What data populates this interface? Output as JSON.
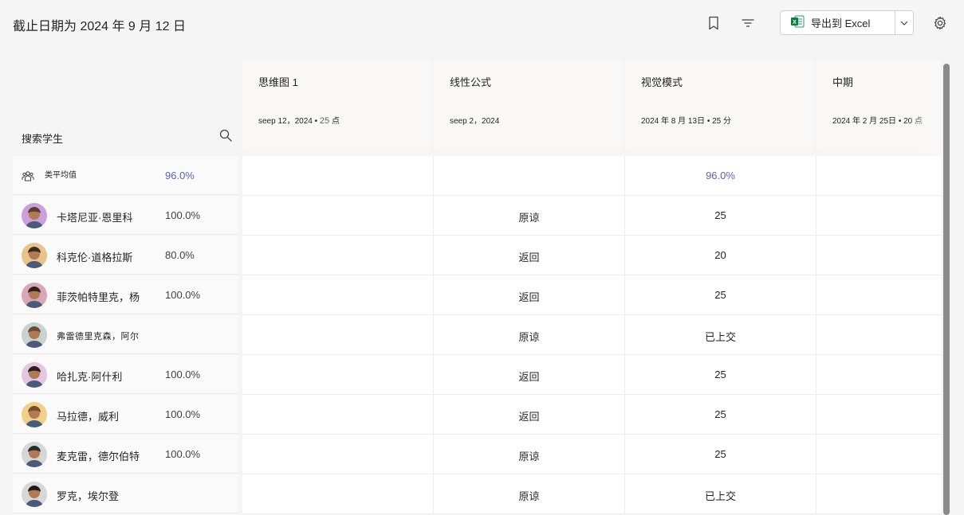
{
  "header": {
    "title": "截止日期为 2024 年 9 月 12 日",
    "export_label": "导出到 Excel"
  },
  "search": {
    "label": "搜索学生"
  },
  "average": {
    "label": "类平均值",
    "grade": "96.0%"
  },
  "columns": [
    {
      "title": "思维图 1",
      "sub": "seep 12，2024 •",
      "sub_points": "25",
      "sub_suffix": "点"
    },
    {
      "title": "线性公式",
      "sub": "seep 2，2024",
      "sub_points": "",
      "sub_suffix": ""
    },
    {
      "title": "视觉模式",
      "sub": "2024 年 8 月 13日 • 25 分",
      "sub_points": "",
      "sub_suffix": ""
    },
    {
      "title": "中期",
      "sub": "2024 年 2 月 25日 • 20 点",
      "sub_points": "",
      "sub_suffix": ""
    }
  ],
  "average_cells": [
    "",
    "",
    "96.0%",
    ""
  ],
  "students": [
    {
      "name": "卡塔尼亚·恩里科",
      "grade": "100.0%",
      "cells": [
        "",
        "原谅",
        "25",
        ""
      ]
    },
    {
      "name": "科克伦·道格拉斯",
      "grade": "80.0%",
      "cells": [
        "",
        "返回",
        "20",
        ""
      ]
    },
    {
      "name": "菲茨帕特里克，杨",
      "grade": "100.0%",
      "cells": [
        "",
        "返回",
        "25",
        ""
      ]
    },
    {
      "name": "弗雷德里克森，阿尔",
      "grade": "",
      "cells": [
        "",
        "原谅",
        "已上交",
        ""
      ]
    },
    {
      "name": "哈扎克·阿什利",
      "grade": "100.0%",
      "cells": [
        "",
        "返回",
        "25",
        ""
      ]
    },
    {
      "name": "马拉德，威利",
      "grade": "100.0%",
      "cells": [
        "",
        "返回",
        "25",
        ""
      ]
    },
    {
      "name": "麦克雷，德尔伯特",
      "grade": "100.0%",
      "cells": [
        "",
        "原谅",
        "25",
        ""
      ]
    },
    {
      "name": "罗克，埃尔登",
      "grade": "",
      "cells": [
        "",
        "原谅",
        "已上交",
        ""
      ]
    }
  ],
  "colors": {
    "accent": "#5b5fc7",
    "excel": "#107c41"
  },
  "icons": [
    "bookmark-icon",
    "filter-icon",
    "excel-icon",
    "chevron-down-icon",
    "gear-icon",
    "search-icon",
    "people-icon"
  ]
}
